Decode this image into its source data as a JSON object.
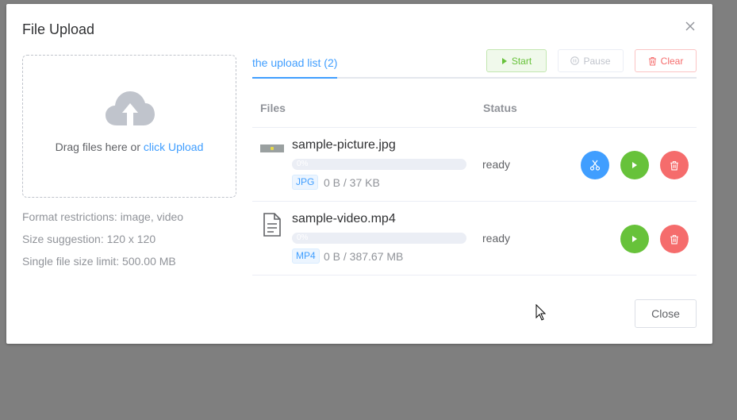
{
  "dialog": {
    "title": "File Upload",
    "close_button_label": "Close"
  },
  "dropzone": {
    "text_prefix": "Drag files here or ",
    "link_text": "click Upload"
  },
  "hints": [
    "Format restrictions: image, video",
    "Size suggestion: 120 x 120",
    "Single file size limit: 500.00 MB"
  ],
  "tabs": {
    "upload_list": "the upload list (2)"
  },
  "toolbar": {
    "start_label": "Start",
    "pause_label": "Pause",
    "clear_label": "Clear"
  },
  "table": {
    "headers": {
      "files": "Files",
      "status": "Status"
    },
    "rows": [
      {
        "name": "sample-picture.jpg",
        "progress_text": "0%",
        "progress_value": 0,
        "type_tag": "JPG",
        "size": "0 B / 37 KB",
        "status": "ready",
        "icon": "image-thumbnail",
        "actions": [
          "crop",
          "play",
          "delete"
        ]
      },
      {
        "name": "sample-video.mp4",
        "progress_text": "0%",
        "progress_value": 0,
        "type_tag": "MP4",
        "size": "0 B / 387.67 MB",
        "status": "ready",
        "icon": "document-icon",
        "actions": [
          "play",
          "delete"
        ]
      }
    ]
  },
  "colors": {
    "primary": "#409eff",
    "success": "#67c23a",
    "danger": "#f56c6c",
    "overlay": "#7f7f7f"
  }
}
